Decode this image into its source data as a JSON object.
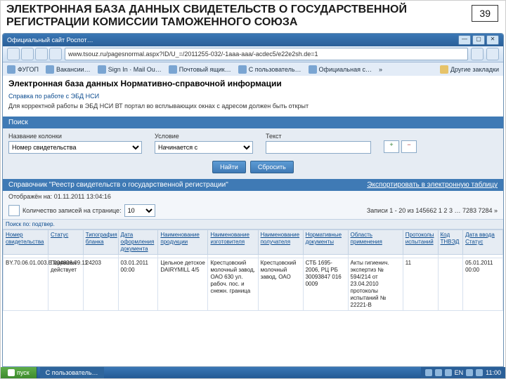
{
  "slide": {
    "title": "ЭЛЕКТРОННАЯ БАЗА ДАННЫХ СВИДЕТЕЛЬСТВ О ГОСУДАРСТВЕННОЙ РЕГИСТРАЦИИ КОМИССИИ ТАМОЖЕННОГО СОЮЗА",
    "page_number": "39"
  },
  "window": {
    "title": "Официальный сайт Роспот…",
    "min": "—",
    "max": "▢",
    "close": "✕",
    "url": "www.tsouz.ru/pagesnormal.aspx?ID/U_=/2011255-032/-1aaa-aaa/-acdec5/e22e2sh.de=1"
  },
  "bookmarks": {
    "items": [
      {
        "label": "ФУГОП"
      },
      {
        "label": "Вакансии…"
      },
      {
        "label": "Sign In · Mail Ou…"
      },
      {
        "label": "Почтовый ящик…"
      },
      {
        "label": "С пользователь…"
      },
      {
        "label": "Официальная с…"
      }
    ],
    "more": "»",
    "other": "Другие закладки"
  },
  "page": {
    "heading": "Электронная база данных Нормативно-справочной информации",
    "help_link": "Справка по работе с ЭБД НСИ",
    "note": "Для корректной работы в ЭБД НСИ ВТ портал во всплывающих окнах с адресом должен быть открыт"
  },
  "search": {
    "header": "Поиск",
    "field_name_label": "Название колонки",
    "field_name_value": "Номер свидетельства",
    "cond_label": "Условие",
    "cond_value": "Начинается с",
    "text_label": "Текст",
    "text_value": "",
    "add_icon": "+",
    "remove_icon": "−",
    "btn_find": "Найти",
    "btn_clear": "Сбросить"
  },
  "section": {
    "title": "Справочник \"Реестр свидетельств о государственной регистрации\"",
    "export": "Экспортировать в электронную таблицу",
    "timestamp_label": "Отображён на:",
    "timestamp": "01.11.2011 13:04:16",
    "perpage_label": "Количество записей на странице:",
    "perpage_value": "10",
    "results": "Записи 1 - 20 из 145662   1 2 3 … 7283 7284  »",
    "cols_sort": "Поиск по: подтвер."
  },
  "table": {
    "headers": [
      "Номер свидетельства",
      "Статус",
      "Типография бланка",
      "Дата оформления документа",
      "Наименование продукции",
      "Наименование изготовителя",
      "Наименование получателя",
      "Нормативные документы",
      "Область применения",
      "Протоколы испытаний",
      "Код ТНВЭД",
      "Дата ввода Статус"
    ],
    "row": {
      "c0": "BY.70.06.01.003.E.004836.09.11",
      "c1": "Подписан действует",
      "c2": "24203",
      "c3": "03.01.2011 00:00",
      "c4": "Цельное детское DAIRYMILL 4/5",
      "c5": "Крестцовский молочный завод, ОАО 630 ул. рабоч. пос. и снежн. граница",
      "c6": "Крестцовский молочный завод, ОАО",
      "c7": "СТБ 1695-2006, РЦ РБ 30093847 016 0009",
      "c8": "Акты гигиенич. экспертиз № 594/214 от 23.04.2010 протоколы испытаний № 22221-В",
      "c9": "11",
      "c10": "",
      "c11": "05.01.2011 00:00"
    }
  },
  "taskbar": {
    "start": "пуск",
    "task1": "С пользователь…",
    "lang": "EN",
    "clock": "11:00"
  }
}
